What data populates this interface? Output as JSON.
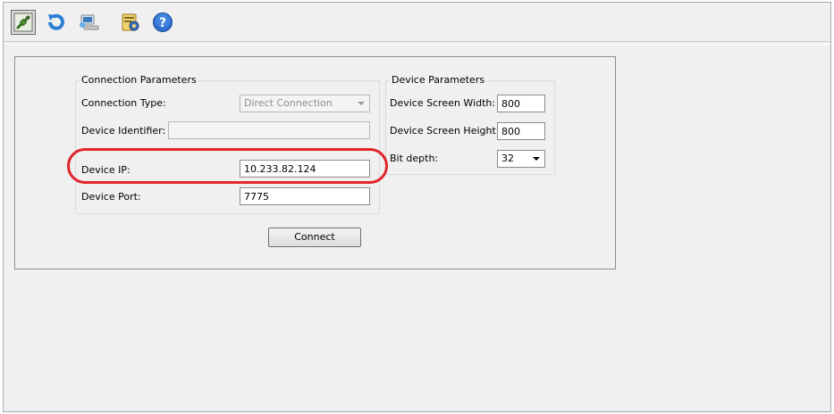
{
  "toolbar": {
    "buttons": [
      {
        "icon": "connect-plug-icon",
        "active": true
      },
      {
        "icon": "refresh-icon"
      },
      {
        "icon": "device-icon"
      },
      {
        "icon": "settings-icon"
      },
      {
        "icon": "help-icon"
      }
    ]
  },
  "connection": {
    "title": "Connection Parameters",
    "type_label": "Connection Type:",
    "type_value": "Direct Connection",
    "identifier_label": "Device Identifier:",
    "identifier_value": "",
    "ip_label": "Device IP:",
    "ip_value": "10.233.82.124",
    "port_label": "Device Port:",
    "port_value": "7775"
  },
  "device": {
    "title": "Device Parameters",
    "width_label": "Device Screen Width:",
    "width_value": "800",
    "height_label": "Device Screen Height:",
    "height_value": "800",
    "bitdepth_label": "Bit depth:",
    "bitdepth_value": "32"
  },
  "connect_button": "Connect",
  "colors": {
    "highlight": "#e0262b",
    "window_bg": "#f0f0f0"
  }
}
